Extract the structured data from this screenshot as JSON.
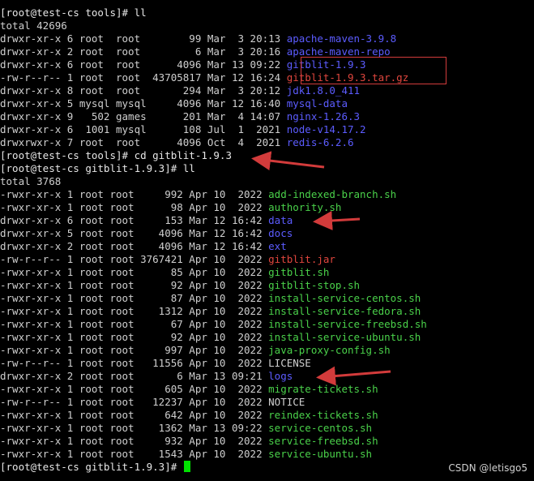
{
  "terminal": {
    "lines": [
      [
        {
          "t": "[root@test-cs tools]# ll",
          "c": "white"
        }
      ],
      [
        {
          "t": "total 42696",
          "c": "default"
        }
      ],
      [
        {
          "t": "drwxr-xr-x 6 root  root        99 Mar  3 20:13 ",
          "c": "default"
        },
        {
          "t": "apache-maven-3.9.8",
          "c": "blue"
        }
      ],
      [
        {
          "t": "drwxr-xr-x 2 root  root         6 Mar  3 20:16 ",
          "c": "default"
        },
        {
          "t": "apache-maven-repo",
          "c": "blue"
        }
      ],
      [
        {
          "t": "drwxr-xr-x 6 root  root      4096 Mar 13 09:22 ",
          "c": "default"
        },
        {
          "t": "gitblit-1.9.3",
          "c": "blue"
        }
      ],
      [
        {
          "t": "-rw-r--r-- 1 root  root  43705817 Mar 12 16:24 ",
          "c": "default"
        },
        {
          "t": "gitblit-1.9.3.tar.gz",
          "c": "red"
        }
      ],
      [
        {
          "t": "drwxr-xr-x 8 root  root       294 Mar  3 20:12 ",
          "c": "default"
        },
        {
          "t": "jdk1.8.0_411",
          "c": "blue"
        }
      ],
      [
        {
          "t": "drwxr-xr-x 5 mysql mysql     4096 Mar 12 16:40 ",
          "c": "default"
        },
        {
          "t": "mysql-data",
          "c": "blue"
        }
      ],
      [
        {
          "t": "drwxr-xr-x 9   502 games      201 Mar  4 14:07 ",
          "c": "default"
        },
        {
          "t": "nginx-1.26.3",
          "c": "blue"
        }
      ],
      [
        {
          "t": "drwxr-xr-x 6  1001 mysql      108 Jul  1  2021 ",
          "c": "default"
        },
        {
          "t": "node-v14.17.2",
          "c": "blue"
        }
      ],
      [
        {
          "t": "drwxrwxr-x 7 root  root      4096 Oct  4  2021 ",
          "c": "default"
        },
        {
          "t": "redis-6.2.6",
          "c": "blue"
        }
      ],
      [
        {
          "t": "[root@test-cs tools]# cd gitblit-1.9.3",
          "c": "white"
        }
      ],
      [
        {
          "t": "[root@test-cs gitblit-1.9.3]# ll",
          "c": "white"
        }
      ],
      [
        {
          "t": "total 3768",
          "c": "default"
        }
      ],
      [
        {
          "t": "-rwxr-xr-x 1 root root     992 Apr 10  2022 ",
          "c": "default"
        },
        {
          "t": "add-indexed-branch.sh",
          "c": "green"
        }
      ],
      [
        {
          "t": "-rwxr-xr-x 1 root root      98 Apr 10  2022 ",
          "c": "default"
        },
        {
          "t": "authority.sh",
          "c": "green"
        }
      ],
      [
        {
          "t": "drwxr-xr-x 6 root root     153 Mar 12 16:42 ",
          "c": "default"
        },
        {
          "t": "data",
          "c": "blue"
        }
      ],
      [
        {
          "t": "drwxr-xr-x 5 root root    4096 Mar 12 16:42 ",
          "c": "default"
        },
        {
          "t": "docs",
          "c": "blue"
        }
      ],
      [
        {
          "t": "drwxr-xr-x 2 root root    4096 Mar 12 16:42 ",
          "c": "default"
        },
        {
          "t": "ext",
          "c": "blue"
        }
      ],
      [
        {
          "t": "-rw-r--r-- 1 root root 3767421 Apr 10  2022 ",
          "c": "default"
        },
        {
          "t": "gitblit.jar",
          "c": "red"
        }
      ],
      [
        {
          "t": "-rwxr-xr-x 1 root root      85 Apr 10  2022 ",
          "c": "default"
        },
        {
          "t": "gitblit.sh",
          "c": "green"
        }
      ],
      [
        {
          "t": "-rwxr-xr-x 1 root root      92 Apr 10  2022 ",
          "c": "default"
        },
        {
          "t": "gitblit-stop.sh",
          "c": "green"
        }
      ],
      [
        {
          "t": "-rwxr-xr-x 1 root root      87 Apr 10  2022 ",
          "c": "default"
        },
        {
          "t": "install-service-centos.sh",
          "c": "green"
        }
      ],
      [
        {
          "t": "-rwxr-xr-x 1 root root    1312 Apr 10  2022 ",
          "c": "default"
        },
        {
          "t": "install-service-fedora.sh",
          "c": "green"
        }
      ],
      [
        {
          "t": "-rwxr-xr-x 1 root root      67 Apr 10  2022 ",
          "c": "default"
        },
        {
          "t": "install-service-freebsd.sh",
          "c": "green"
        }
      ],
      [
        {
          "t": "-rwxr-xr-x 1 root root      92 Apr 10  2022 ",
          "c": "default"
        },
        {
          "t": "install-service-ubuntu.sh",
          "c": "green"
        }
      ],
      [
        {
          "t": "-rwxr-xr-x 1 root root     997 Apr 10  2022 ",
          "c": "default"
        },
        {
          "t": "java-proxy-config.sh",
          "c": "green"
        }
      ],
      [
        {
          "t": "-rw-r--r-- 1 root root   11556 Apr 10  2022 ",
          "c": "default"
        },
        {
          "t": "LICENSE",
          "c": "default"
        }
      ],
      [
        {
          "t": "drwxr-xr-x 2 root root       6 Mar 13 09:21 ",
          "c": "default"
        },
        {
          "t": "logs",
          "c": "blue"
        }
      ],
      [
        {
          "t": "-rwxr-xr-x 1 root root     605 Apr 10  2022 ",
          "c": "default"
        },
        {
          "t": "migrate-tickets.sh",
          "c": "green"
        }
      ],
      [
        {
          "t": "-rw-r--r-- 1 root root   12237 Apr 10  2022 ",
          "c": "default"
        },
        {
          "t": "NOTICE",
          "c": "default"
        }
      ],
      [
        {
          "t": "-rwxr-xr-x 1 root root     642 Apr 10  2022 ",
          "c": "default"
        },
        {
          "t": "reindex-tickets.sh",
          "c": "green"
        }
      ],
      [
        {
          "t": "-rwxr-xr-x 1 root root    1362 Mar 13 09:22 ",
          "c": "default"
        },
        {
          "t": "service-centos.sh",
          "c": "green"
        }
      ],
      [
        {
          "t": "-rwxr-xr-x 1 root root     932 Apr 10  2022 ",
          "c": "default"
        },
        {
          "t": "service-freebsd.sh",
          "c": "green"
        }
      ],
      [
        {
          "t": "-rwxr-xr-x 1 root root    1543 Apr 10  2022 ",
          "c": "default"
        },
        {
          "t": "service-ubuntu.sh",
          "c": "green"
        }
      ],
      [
        {
          "t": "[root@test-cs gitblit-1.9.3]# ",
          "c": "white"
        }
      ]
    ]
  },
  "watermark": "CSDN @letisgo5",
  "colors": {
    "background": "#000000",
    "default": "#cfcfcf",
    "directory": "#5c5cff",
    "executable": "#4ad14a",
    "archive": "#e0463e",
    "cursor": "#00e000",
    "annotation": "#d23b3b"
  }
}
